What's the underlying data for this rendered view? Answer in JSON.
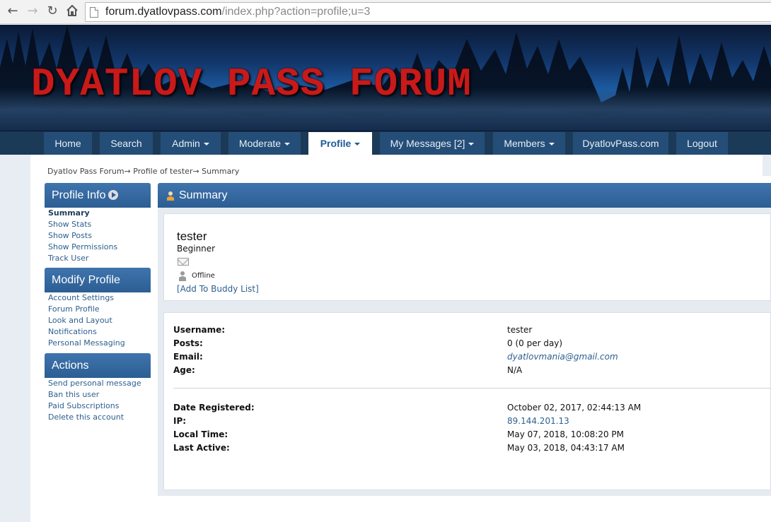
{
  "browser": {
    "url_host": "forum.dyatlovpass.com",
    "url_path": "/index.php?action=profile;u=3"
  },
  "banner": {
    "title": "DYATLOV PASS FORUM"
  },
  "nav": [
    {
      "label": "Home",
      "has_menu": false,
      "active": false
    },
    {
      "label": "Search",
      "has_menu": false,
      "active": false
    },
    {
      "label": "Admin",
      "has_menu": true,
      "active": false
    },
    {
      "label": "Moderate",
      "has_menu": true,
      "active": false
    },
    {
      "label": "Profile",
      "has_menu": true,
      "active": true
    },
    {
      "label": "My Messages [2]",
      "has_menu": true,
      "active": false
    },
    {
      "label": "Members",
      "has_menu": true,
      "active": false
    },
    {
      "label": "DyatlovPass.com",
      "has_menu": false,
      "active": false
    },
    {
      "label": "Logout",
      "has_menu": false,
      "active": false
    }
  ],
  "breadcrumb": "Dyatlov Pass Forum→ Profile of tester→ Summary",
  "sidebar": {
    "profile_info": {
      "title": "Profile Info",
      "items": [
        "Summary",
        "Show Stats",
        "Show Posts",
        "Show Permissions",
        "Track User"
      ]
    },
    "modify_profile": {
      "title": "Modify Profile",
      "items": [
        "Account Settings",
        "Forum Profile",
        "Look and Layout",
        "Notifications",
        "Personal Messaging"
      ]
    },
    "actions": {
      "title": "Actions",
      "items": [
        "Send personal message",
        "Ban this user",
        "Paid Subscriptions",
        "Delete this account"
      ]
    }
  },
  "summary": {
    "title": "Summary",
    "username": "tester",
    "member_title": "Beginner",
    "status": "Offline",
    "buddy_link": "[Add To Buddy List]",
    "details": [
      {
        "label": "Username:",
        "value": "tester"
      },
      {
        "label": "Posts:",
        "value": "0 (0 per day)"
      },
      {
        "label": "Email:",
        "value": "dyatlovmania@gmail.com"
      },
      {
        "label": "Age:",
        "value": "N/A"
      }
    ],
    "details2": [
      {
        "label": "Date Registered:",
        "value": "October 02, 2017, 02:44:13 AM"
      },
      {
        "label": "IP:",
        "value": "89.144.201.13"
      },
      {
        "label": "Local Time:",
        "value": "May 07, 2018, 10:08:20 PM"
      },
      {
        "label": "Last Active:",
        "value": "May 03, 2018, 04:43:17 AM"
      }
    ]
  }
}
